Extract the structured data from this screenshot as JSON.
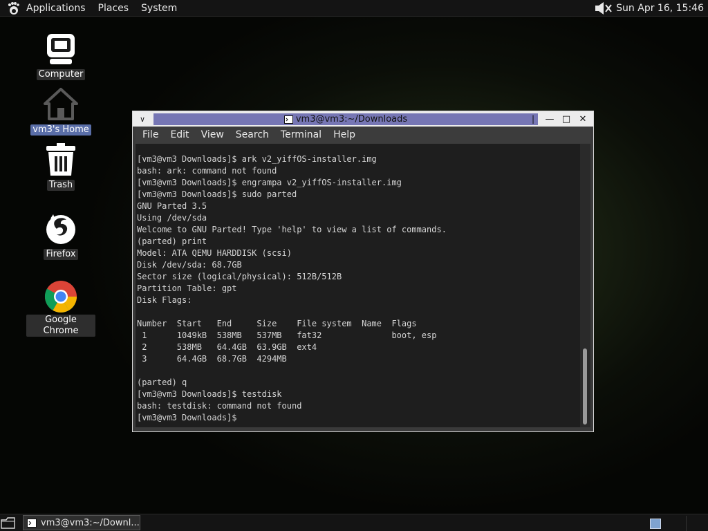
{
  "top_panel": {
    "menus": [
      "Applications",
      "Places",
      "System"
    ],
    "clock": "Sun Apr 16, 15:46"
  },
  "desktop": {
    "icons": [
      {
        "label": "Computer",
        "icon": "computer-icon"
      },
      {
        "label": "vm3's Home",
        "icon": "home-folder-icon",
        "selected": true
      },
      {
        "label": "Trash",
        "icon": "trash-icon"
      },
      {
        "label": "Firefox",
        "icon": "firefox-icon"
      },
      {
        "label": "Google Chrome",
        "icon": "chrome-icon"
      }
    ]
  },
  "window": {
    "title": "vm3@vm3:~/Downloads",
    "menu": [
      "File",
      "Edit",
      "View",
      "Search",
      "Terminal",
      "Help"
    ],
    "lines": [
      "[vm3@vm3 Downloads]$ ark v2_yiffOS-installer.img",
      "bash: ark: command not found",
      "[vm3@vm3 Downloads]$ engrampa v2_yiffOS-installer.img",
      "[vm3@vm3 Downloads]$ sudo parted",
      "GNU Parted 3.5",
      "Using /dev/sda",
      "Welcome to GNU Parted! Type 'help' to view a list of commands.",
      "(parted) print",
      "Model: ATA QEMU HARDDISK (scsi)",
      "Disk /dev/sda: 68.7GB",
      "Sector size (logical/physical): 512B/512B",
      "Partition Table: gpt",
      "Disk Flags:",
      "",
      "Number  Start   End     Size    File system  Name  Flags",
      " 1      1049kB  538MB   537MB   fat32              boot, esp",
      " 2      538MB   64.4GB  63.9GB  ext4",
      " 3      64.4GB  68.7GB  4294MB",
      "",
      "(parted) q",
      "[vm3@vm3 Downloads]$ testdisk",
      "bash: testdisk: command not found",
      "[vm3@vm3 Downloads]$"
    ]
  },
  "taskbar": {
    "task_label": "vm3@vm3:~/Downl..."
  },
  "colors": {
    "title_active": "#7676b4",
    "terminal_bg": "#1e1e1e",
    "selected_label": "#5a6ea8"
  }
}
